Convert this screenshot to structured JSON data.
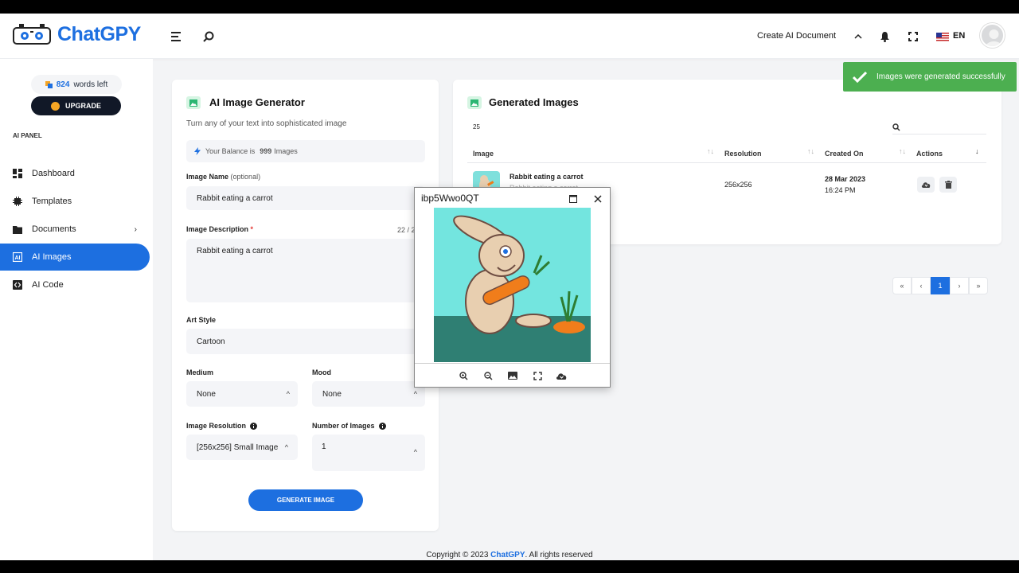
{
  "app": {
    "brand": "ChatGPY",
    "create_doc": "Create AI Document",
    "language": "EN"
  },
  "sidebar": {
    "words_count": "824",
    "words_suffix": "words left",
    "upgrade": "UPGRADE",
    "panel_label": "AI PANEL",
    "items": [
      {
        "label": "Dashboard",
        "icon": "dashboard-icon"
      },
      {
        "label": "Templates",
        "icon": "templates-icon"
      },
      {
        "label": "Documents",
        "icon": "folder-icon"
      },
      {
        "label": "AI Images",
        "icon": "ai-images-icon"
      },
      {
        "label": "AI Code",
        "icon": "code-icon"
      }
    ],
    "active_item": "AI Images"
  },
  "generator": {
    "title": "AI Image Generator",
    "subtitle": "Turn any of your text into sophisticated image",
    "balance_prefix": "Your Balance is",
    "balance_value": "999",
    "balance_suffix": "Images",
    "image_name_label": "Image Name",
    "image_name_optional": "(optional)",
    "image_name_value": "Rabbit eating a carrot",
    "description_label": "Image Description",
    "description_required": "*",
    "description_count": "22 / 2",
    "description_value": "Rabbit eating a carrot",
    "art_style_label": "Art Style",
    "art_style_value": "Cartoon",
    "medium_label": "Medium",
    "medium_value": "None",
    "mood_label": "Mood",
    "mood_value": "None",
    "resolution_label": "Image Resolution",
    "resolution_value": "[256x256] Small Image",
    "number_label": "Number of Images",
    "number_value": "1",
    "generate_button": "GENERATE IMAGE"
  },
  "generated": {
    "title": "Generated Images",
    "page_size": "25",
    "columns": [
      "Image",
      "Resolution",
      "Created On",
      "Actions"
    ],
    "rows": [
      {
        "name": "Rabbit eating a carrot",
        "description": "Rabbit eating a carrot",
        "resolution": "256x256",
        "date": "28 Mar 2023",
        "time": "16:24 PM"
      }
    ],
    "pagination": [
      "«",
      "‹",
      "1",
      "›",
      "»"
    ],
    "current_page": "1"
  },
  "toast": {
    "message": "Images were generated successfully",
    "color": "#4caf50"
  },
  "modal": {
    "title": "ibp5Wwo0QT",
    "toolbar": [
      "zoom-in-icon",
      "zoom-out-icon",
      "image-icon",
      "fullscreen-icon",
      "download-icon"
    ]
  },
  "footer": {
    "prefix": "Copyright © 2023",
    "brand": "ChatGPY",
    "suffix": ". All rights reserved"
  },
  "colors": {
    "accent": "#1d6fe0",
    "dark_button": "#111827",
    "success": "#4caf50"
  }
}
